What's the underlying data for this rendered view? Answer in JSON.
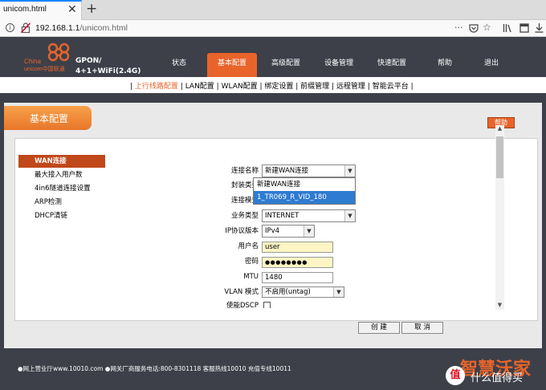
{
  "browser": {
    "tab_title": "unicom.html",
    "close_glyph": "✕",
    "new_tab_glyph": "+",
    "url_host": "192.168.1.1",
    "url_path": "/unicom.html",
    "icons": [
      "info-icon",
      "insecure-lock-icon",
      "more-icon",
      "pocket-icon",
      "star-icon",
      "library-icon",
      "reader-icon",
      "download-icon"
    ]
  },
  "header": {
    "logo_china": "China",
    "logo_unicom": "unicom中国联通",
    "model_line1": "GPON/",
    "model_line2": "4+1+WiFi(2.4G)",
    "menu": [
      "状态",
      "基本配置",
      "高级配置",
      "设备管理",
      "快速配置",
      "帮助",
      "退出"
    ],
    "active_menu_index": 1
  },
  "submenu": {
    "active": "上行线路配置",
    "items": [
      "LAN配置",
      "WLAN配置",
      "绑定设置",
      "前缀管理",
      "远程管理",
      "智能云平台"
    ]
  },
  "section": {
    "title": "基本配置",
    "help_label": "帮助"
  },
  "sidebar": {
    "items": [
      "WAN连接",
      "最大接入用户数",
      "4in6隧道连接设置",
      "ARP检测",
      "DHCP清链"
    ],
    "active_index": 0
  },
  "form": {
    "connection_name_label": "连接名称",
    "connection_name_value": "新建WAN连接",
    "encap_label": "封装类型",
    "conn_mode_label": "连接模式",
    "service_type_label": "业务类型",
    "service_type_value": "INTERNET",
    "ip_version_label": "IP协议版本",
    "ip_version_value": "IPv4",
    "username_label": "用户名",
    "username_value": "user",
    "password_label": "密码",
    "password_value": "●●●●●●●●",
    "mtu_label": "MTU",
    "mtu_value": "1480",
    "vlan_label": "VLAN 模式",
    "vlan_value": "不启用(untag)",
    "dscp_label": "使能DSCP"
  },
  "dropdown": {
    "options": [
      "新建WAN连接",
      "1_TR069_R_VID_180"
    ],
    "highlighted_index": 1
  },
  "buttons": {
    "create": "创 建",
    "cancel": "取 消"
  },
  "footer": {
    "text": "●网上营业厅www.10010.com ●网关厂商服务电话:800-8301118 客服热线10010 充值专线10011",
    "brand": "智慧沃家",
    "watermark": "什么值得买",
    "badge": "值"
  },
  "colors": {
    "accent": "#e8642b",
    "page_bg": "#3d4049",
    "selection": "#2e7bd1"
  }
}
